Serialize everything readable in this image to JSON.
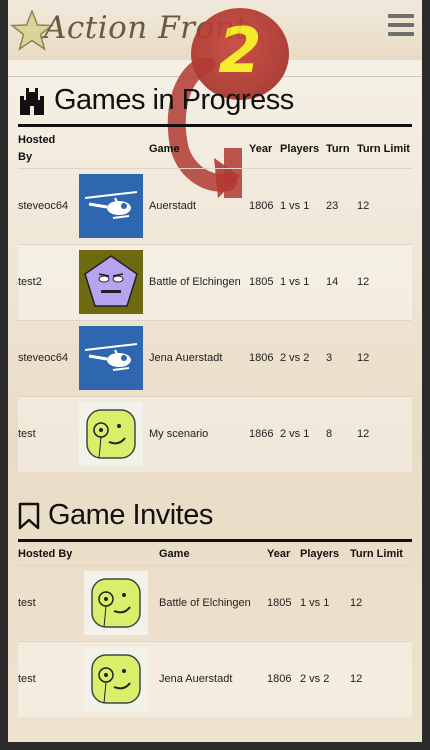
{
  "header": {
    "logo_text": "Action Front",
    "badge_number": "2"
  },
  "games_in_progress": {
    "title": "Games in Progress",
    "columns": {
      "hosted_by": "Hosted By",
      "game": "Game",
      "year": "Year",
      "players": "Players",
      "turn": "Turn",
      "turn_limit": "Turn Limit"
    },
    "rows": [
      {
        "host": "steveoc64",
        "avatar": "helicopter-avatar",
        "game": "Auerstadt",
        "year": "1806",
        "players": "1 vs 1",
        "turn": "23",
        "turn_limit": "12"
      },
      {
        "host": "test2",
        "avatar": "purple-pentagon-avatar",
        "game": "Battle of Elchingen",
        "year": "1805",
        "players": "1 vs 1",
        "turn": "14",
        "turn_limit": "12"
      },
      {
        "host": "steveoc64",
        "avatar": "helicopter-avatar",
        "game": "Jena Auerstadt",
        "year": "1806",
        "players": "2 vs 2",
        "turn": "3",
        "turn_limit": "12"
      },
      {
        "host": "test",
        "avatar": "monocle-face-avatar",
        "game": "My scenario",
        "year": "1866",
        "players": "2 vs 1",
        "turn": "8",
        "turn_limit": "12"
      }
    ]
  },
  "game_invites": {
    "title": "Game Invites",
    "columns": {
      "hosted_by": "Hosted By",
      "game": "Game",
      "year": "Year",
      "players": "Players",
      "turn_limit": "Turn Limit"
    },
    "rows": [
      {
        "host": "test",
        "avatar": "monocle-face-avatar",
        "game": "Battle of Elchingen",
        "year": "1805",
        "players": "1 vs 1",
        "turn_limit": "12"
      },
      {
        "host": "test",
        "avatar": "monocle-face-avatar",
        "game": "Jena Auerstadt",
        "year": "1806",
        "players": "2 vs 2",
        "turn_limit": "12"
      }
    ]
  },
  "colors": {
    "badge_red": "#a8342c",
    "badge_number_yellow": "#f5ec1c",
    "arrow_red": "#b23a33"
  }
}
